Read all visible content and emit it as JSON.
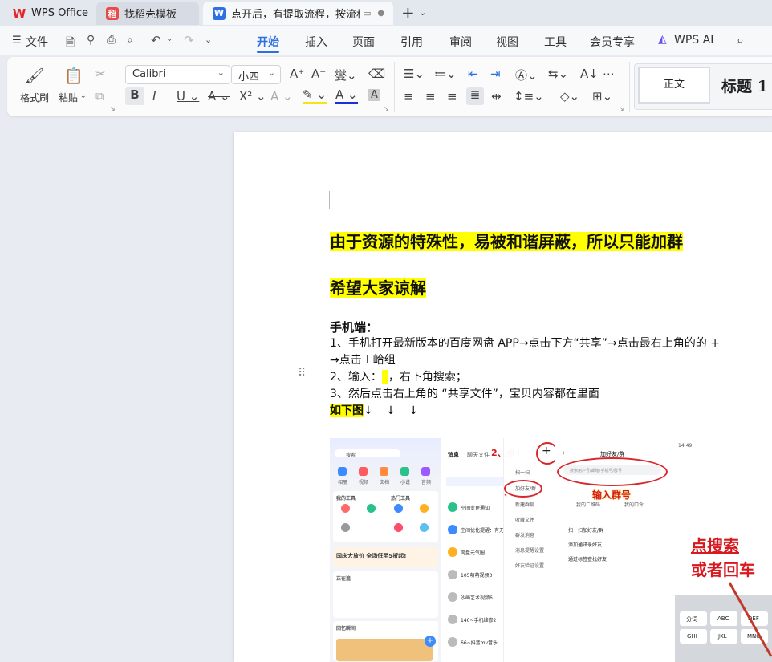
{
  "tabs": [
    {
      "label": "WPS Office",
      "icon": "wps-logo-icon"
    },
    {
      "label": "找稻壳模板",
      "icon": "docer-icon"
    },
    {
      "label": "点开后，有提取流程，按流程",
      "icon": "writer-doc-icon"
    }
  ],
  "menu": {
    "file": "文件",
    "items": [
      "开始",
      "插入",
      "页面",
      "引用",
      "审阅",
      "视图",
      "工具",
      "会员专享"
    ],
    "active": "开始",
    "wps_ai": "WPS AI"
  },
  "ribbon": {
    "format_painter": "格式刷",
    "paste": "粘贴",
    "font_name": "Calibri",
    "font_size": "小四",
    "styles": [
      "正文",
      "标题 1"
    ]
  },
  "document": {
    "heading1": "由于资源的特殊性，易被和谐屏蔽，所以只能加群",
    "heading2": "希望大家谅解",
    "mobile_title": "手机端：",
    "line1": "1、手机打开最新版本的百度网盘 APP→点击下方“共享”→点击最右上角的的 +",
    "line1b": "→点击＋峆组",
    "line2a": "2、输入：",
    "line2b": "，右下角搜索；",
    "line3": "3、然后点击右上角的 “共享文件”，宝贝内容都在里面",
    "see_below": "如下图",
    "arrows": "↓  ↓  ↓"
  },
  "screenshot": {
    "p1": {
      "search": "搜索",
      "tools": "我的工具",
      "hot": "热门工具",
      "banner": "国庆大放价 全场低至5折起!",
      "recent": "正在追",
      "memory": "回忆瞬间",
      "apps": [
        "相册",
        "视频",
        "文档",
        "小说",
        "音频"
      ]
    },
    "p2": {
      "tab1": "消息",
      "tab2": "聊天文件",
      "step": "2、点+",
      "rows": [
        "空间变更通知",
        "空间优化提醒：有无",
        "网盘元气圈",
        "105萌萌视频3",
        "沙画艺术视频6",
        "140~手机维修2",
        "66~抖音mv音乐"
      ]
    },
    "p3": {
      "menu": [
        "扫一扫",
        "加好友/群",
        "新建群聊",
        "收藏文件",
        "群发消息",
        "消息提醒设置",
        "好友验证设置"
      ],
      "step": "3、"
    },
    "p4": {
      "title": "加好友/群",
      "search_ph": "搜索用户号/邮箱/手机号/群号",
      "hint": "输入群号",
      "opt1": "我的二维码",
      "opt2": "我的口令",
      "rows": [
        "扫一扫加好友/群",
        "添加通讯录好友",
        "通过标签查找好友"
      ]
    },
    "p5": {
      "time": "14:49",
      "hint1": "点搜索",
      "hint2": "或者回车",
      "keys": [
        "分词",
        "ABC",
        "DEF",
        "GHI",
        "JKL",
        "MNO"
      ]
    }
  }
}
